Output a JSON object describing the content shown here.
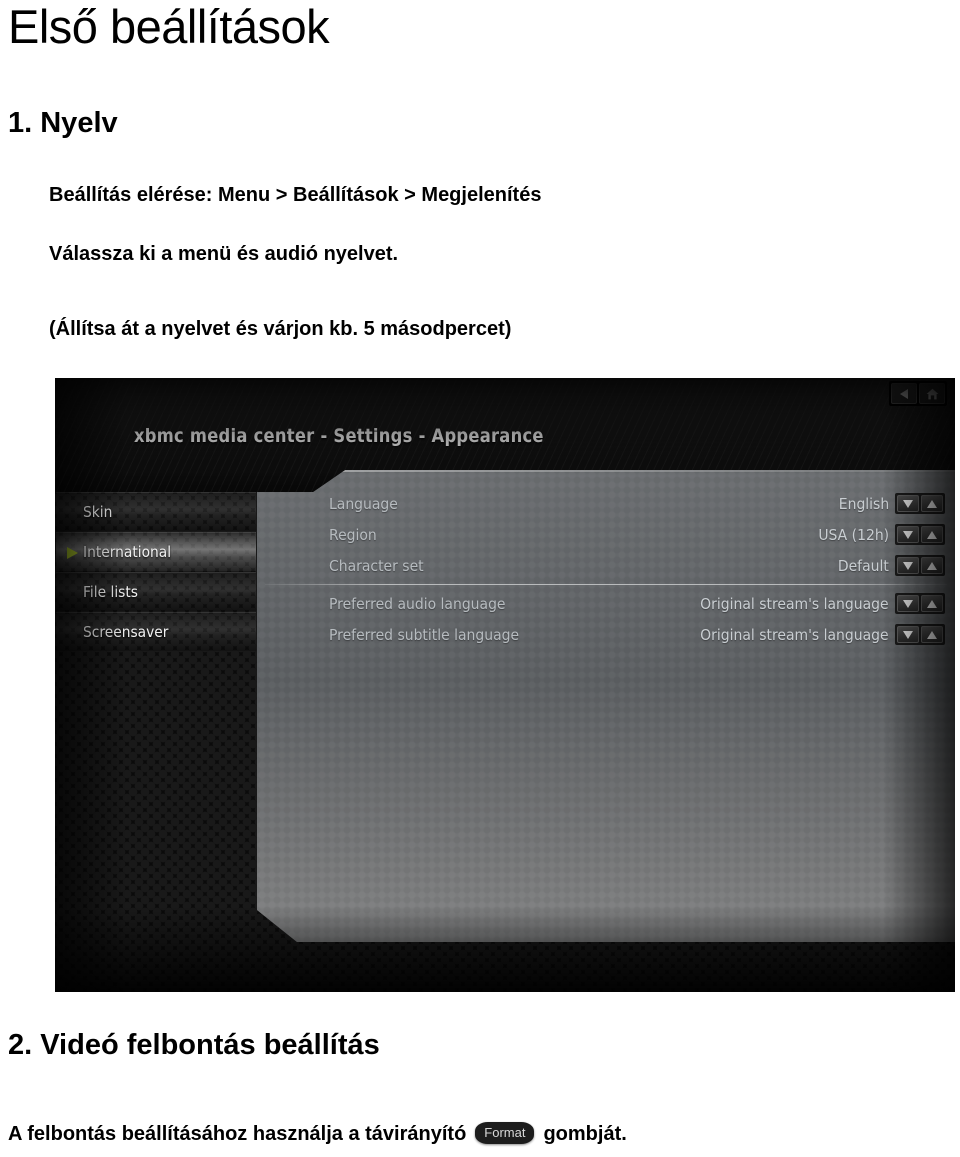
{
  "document": {
    "title": "Első beállítások",
    "section1_heading": "1. Nyelv",
    "line_path": "Beállítás elérése: Menu > Beállítások > Megjelenítés",
    "line_pick": "Válassza ki a menü és audió nyelvet.",
    "line_wait": "(Állítsa át a nyelvet és várjon kb. 5 másodpercet)",
    "section2_heading": "2. Videó felbontás beállítás",
    "footer_before": "A felbontás beállításához használja a távirányító",
    "footer_key": "Format",
    "footer_after": "gombját."
  },
  "xbmc": {
    "window_title": "xbmc media center - Settings - Appearance",
    "nav": {
      "back_icon": "back-arrow-icon",
      "home_icon": "home-icon"
    },
    "categories": [
      {
        "label": "Skin",
        "selected": false
      },
      {
        "label": "International",
        "selected": true
      },
      {
        "label": "File lists",
        "selected": false
      },
      {
        "label": "Screensaver",
        "selected": false
      }
    ],
    "settings": [
      {
        "label": "Language",
        "value": "English",
        "divider_before": false
      },
      {
        "label": "Region",
        "value": "USA (12h)",
        "divider_before": false
      },
      {
        "label": "Character set",
        "value": "Default",
        "divider_before": false
      },
      {
        "label": "Preferred audio language",
        "value": "Original stream's language",
        "divider_before": true
      },
      {
        "label": "Preferred subtitle language",
        "value": "Original stream's language",
        "divider_before": false
      }
    ],
    "spinner": {
      "down_icon": "triangle-down-icon",
      "up_icon": "triangle-up-icon"
    },
    "colors": {
      "selection_arrow": "#a8c22a",
      "panel_bg": "#5d6063",
      "header_bg": "#161616",
      "label_text": "#b7bcc0",
      "value_text": "#c9ced2"
    }
  }
}
